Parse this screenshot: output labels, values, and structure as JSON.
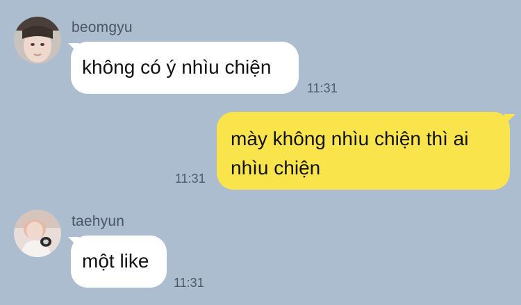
{
  "messages": [
    {
      "sender": "beomgyu",
      "avatar": "beomgyu-avatar",
      "text": "không có ý nhìu chiện",
      "time": "11:31",
      "direction": "incoming"
    },
    {
      "text_line1": "mày không nhìu chiện thì ai",
      "text_line2": "nhìu chiện",
      "time": "11:31",
      "direction": "outgoing"
    },
    {
      "sender": "taehyun",
      "avatar": "taehyun-avatar",
      "text": "một like",
      "time": "11:31",
      "direction": "incoming"
    }
  ],
  "colors": {
    "background": "#adbdd0",
    "incoming_bubble": "#ffffff",
    "outgoing_bubble": "#f9e54b"
  }
}
